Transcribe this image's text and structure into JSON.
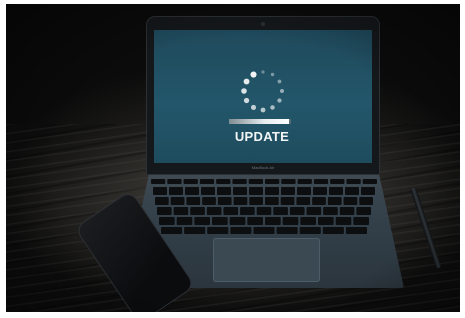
{
  "screen": {
    "label": "UPDATE",
    "progress_fraction": 0.97,
    "brand_text": "MacBook Air"
  },
  "colors": {
    "screen": "#23566a",
    "laptop_body": "#33404a",
    "table": "#2a2926"
  },
  "icons": {
    "spinner": "loading-spinner-icon"
  }
}
